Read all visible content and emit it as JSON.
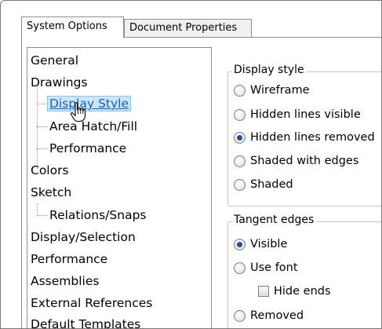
{
  "tabs": [
    {
      "label": "System Options",
      "active": true
    },
    {
      "label": "Document Properties",
      "active": false
    }
  ],
  "tree": {
    "items": [
      {
        "label": "General",
        "level": 0
      },
      {
        "label": "Drawings",
        "level": 0
      },
      {
        "label": "Display Style",
        "level": 1,
        "selected": true
      },
      {
        "label": "Area Hatch/Fill",
        "level": 1
      },
      {
        "label": "Performance",
        "level": 1
      },
      {
        "label": "Colors",
        "level": 0
      },
      {
        "label": "Sketch",
        "level": 0
      },
      {
        "label": "Relations/Snaps",
        "level": 1
      },
      {
        "label": "Display/Selection",
        "level": 0
      },
      {
        "label": "Performance",
        "level": 0
      },
      {
        "label": "Assemblies",
        "level": 0
      },
      {
        "label": "External References",
        "level": 0
      },
      {
        "label": "Default Templates",
        "level": 0
      }
    ]
  },
  "display_style": {
    "title": "Display style",
    "options": [
      {
        "label": "Wireframe",
        "checked": false
      },
      {
        "label": "Hidden lines visible",
        "checked": false
      },
      {
        "label": "Hidden lines removed",
        "checked": true
      },
      {
        "label": "Shaded with edges",
        "checked": false
      },
      {
        "label": "Shaded",
        "checked": false
      }
    ]
  },
  "tangent_edges": {
    "title": "Tangent edges",
    "options": [
      {
        "label": "Visible",
        "checked": true
      },
      {
        "label": "Use font",
        "checked": false
      },
      {
        "label": "Removed",
        "checked": false
      }
    ],
    "hide_ends_label": "Hide ends",
    "hide_ends_checked": false
  },
  "colors": {
    "selection_bg": "#cde6f7",
    "selection_text": "#1a5fb4",
    "radio_dot": "#1d4fa3"
  }
}
